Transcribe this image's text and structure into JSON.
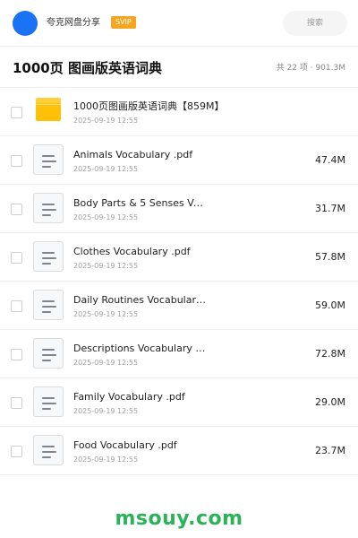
{
  "header": {
    "brand": "夸克网盘分享",
    "badge": "SVIP",
    "search_placeholder": "搜索",
    "avatar_color": "#1a73f5",
    "badge_color": "#f5a524"
  },
  "folder_view": {
    "title": "1000页 图画版英语词典",
    "summary": "共 22 项 · 901.3M"
  },
  "items": [
    {
      "type": "folder",
      "icon": "folder-icon",
      "name": "1000页图画版英语词典【859M】",
      "date": "2025-09-19 12:55",
      "size": ""
    },
    {
      "type": "file",
      "icon": "document-icon",
      "name": "Animals Vocabulary .pdf",
      "date": "2025-09-19 12:55",
      "size": "47.4M"
    },
    {
      "type": "file",
      "icon": "document-icon",
      "name": "Body Parts & 5 Senses Voc…",
      "date": "2025-09-19 12:55",
      "size": "31.7M"
    },
    {
      "type": "file",
      "icon": "document-icon",
      "name": "Clothes Vocabulary .pdf",
      "date": "2025-09-19 12:55",
      "size": "57.8M"
    },
    {
      "type": "file",
      "icon": "document-icon",
      "name": "Daily Routines Vocabulary…",
      "date": "2025-09-19 12:55",
      "size": "59.0M"
    },
    {
      "type": "file",
      "icon": "document-icon",
      "name": "Descriptions Vocabulary .…",
      "date": "2025-09-19 12:55",
      "size": "72.8M"
    },
    {
      "type": "file",
      "icon": "document-icon",
      "name": "Family Vocabulary .pdf",
      "date": "2025-09-19 12:55",
      "size": "29.0M"
    },
    {
      "type": "file",
      "icon": "document-icon",
      "name": "Food Vocabulary .pdf",
      "date": "2025-09-19 12:55",
      "size": "23.7M"
    }
  ],
  "watermark": {
    "text": "msouy.com",
    "color": "#2bb35a"
  }
}
